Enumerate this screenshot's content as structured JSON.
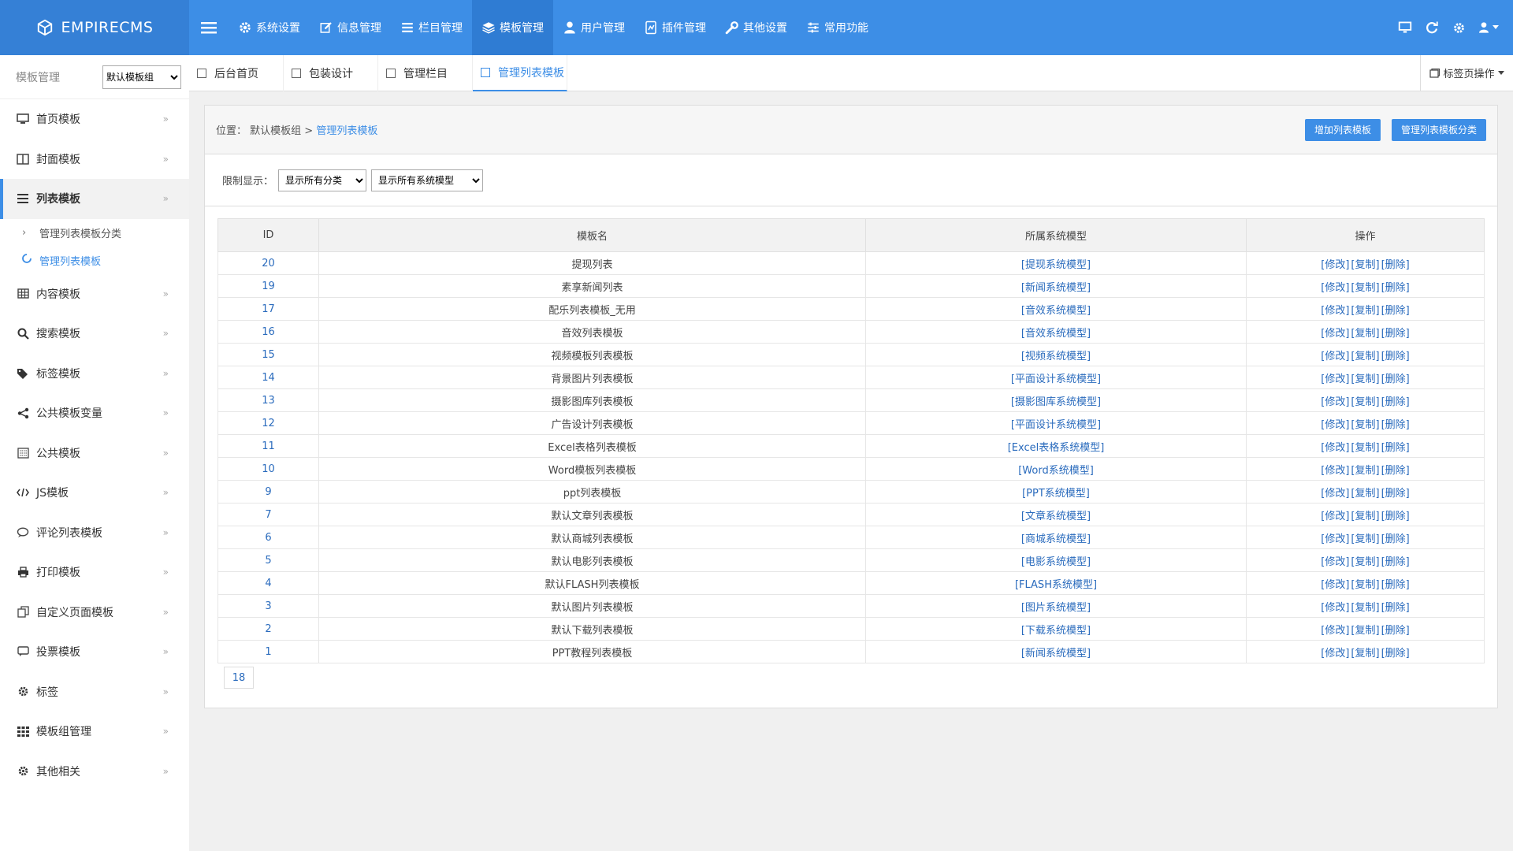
{
  "app": {
    "logo": "EMPIRECMS"
  },
  "topnav": {
    "items": [
      {
        "label": "系统设置",
        "icon": "gear-icon"
      },
      {
        "label": "信息管理",
        "icon": "edit-icon"
      },
      {
        "label": "栏目管理",
        "icon": "list-icon"
      },
      {
        "label": "模板管理",
        "icon": "layers-icon",
        "active": true
      },
      {
        "label": "用户管理",
        "icon": "user-icon"
      },
      {
        "label": "插件管理",
        "icon": "plugin-icon"
      },
      {
        "label": "其他设置",
        "icon": "wrench-icon"
      },
      {
        "label": "常用功能",
        "icon": "sliders-icon"
      }
    ]
  },
  "sidebar": {
    "title": "模板管理",
    "group_select": "默认模板组",
    "items": [
      {
        "label": "首页模板",
        "icon": "monitor-icon"
      },
      {
        "label": "封面模板",
        "icon": "columns-icon"
      },
      {
        "label": "列表模板",
        "icon": "list-icon",
        "expanded": true
      },
      {
        "label": "内容模板",
        "icon": "table-icon"
      },
      {
        "label": "搜索模板",
        "icon": "search-icon"
      },
      {
        "label": "标签模板",
        "icon": "tag-icon"
      },
      {
        "label": "公共模板变量",
        "icon": "share-icon"
      },
      {
        "label": "公共模板",
        "icon": "calendar-icon"
      },
      {
        "label": "JS模板",
        "icon": "code-icon"
      },
      {
        "label": "评论列表模板",
        "icon": "comment-icon"
      },
      {
        "label": "打印模板",
        "icon": "print-icon"
      },
      {
        "label": "自定义页面模板",
        "icon": "copy-icon"
      },
      {
        "label": "投票模板",
        "icon": "chat-icon"
      },
      {
        "label": "标签",
        "icon": "gear-icon"
      },
      {
        "label": "模板组管理",
        "icon": "grid-icon"
      },
      {
        "label": "其他相关",
        "icon": "gear-icon"
      }
    ],
    "subitems": [
      {
        "label": "管理列表模板分类"
      },
      {
        "label": "管理列表模板",
        "current": true
      }
    ]
  },
  "tabs": {
    "items": [
      {
        "label": "后台首页"
      },
      {
        "label": "包装设计"
      },
      {
        "label": "管理栏目"
      },
      {
        "label": "管理列表模板",
        "active": true
      }
    ],
    "ops_label": "标签页操作"
  },
  "main": {
    "breadcrumb_prefix": "位置： 默认模板组 >",
    "breadcrumb_current": "管理列表模板",
    "btn_add": "增加列表模板",
    "btn_manage": "管理列表模板分类",
    "filter_label": "限制显示：",
    "filter_class": "显示所有分类",
    "filter_model": "显示所有系统模型",
    "columns": [
      "ID",
      "模板名",
      "所属系统模型",
      "操作"
    ],
    "op_edit": "[修改]",
    "op_copy": "[复制]",
    "op_delete": "[删除]",
    "rows": [
      {
        "id": "20",
        "name": "提现列表",
        "model": "[提现系统模型]"
      },
      {
        "id": "19",
        "name": "素享新闻列表",
        "model": "[新闻系统模型]"
      },
      {
        "id": "17",
        "name": "配乐列表模板_无用",
        "model": "[音效系统模型]"
      },
      {
        "id": "16",
        "name": "音效列表模板",
        "model": "[音效系统模型]"
      },
      {
        "id": "15",
        "name": "视频模板列表模板",
        "model": "[视频系统模型]"
      },
      {
        "id": "14",
        "name": "背景图片列表模板",
        "model": "[平面设计系统模型]"
      },
      {
        "id": "13",
        "name": "摄影图库列表模板",
        "model": "[摄影图库系统模型]"
      },
      {
        "id": "12",
        "name": "广告设计列表模板",
        "model": "[平面设计系统模型]"
      },
      {
        "id": "11",
        "name": "Excel表格列表模板",
        "model": "[Excel表格系统模型]"
      },
      {
        "id": "10",
        "name": "Word模板列表模板",
        "model": "[Word系统模型]"
      },
      {
        "id": "9",
        "name": "ppt列表模板",
        "model": "[PPT系统模型]"
      },
      {
        "id": "7",
        "name": "默认文章列表模板",
        "model": "[文章系统模型]"
      },
      {
        "id": "6",
        "name": "默认商城列表模板",
        "model": "[商城系统模型]"
      },
      {
        "id": "5",
        "name": "默认电影列表模板",
        "model": "[电影系统模型]"
      },
      {
        "id": "4",
        "name": "默认FLASH列表模板",
        "model": "[FLASH系统模型]"
      },
      {
        "id": "3",
        "name": "默认图片列表模板",
        "model": "[图片系统模型]"
      },
      {
        "id": "2",
        "name": "默认下载列表模板",
        "model": "[下载系统模型]"
      },
      {
        "id": "1",
        "name": "PPT教程列表模板",
        "model": "[新闻系统模型]"
      }
    ],
    "total_count": "18"
  },
  "colors": {
    "primary": "#3d8ee6",
    "link": "#2a6bbd"
  }
}
